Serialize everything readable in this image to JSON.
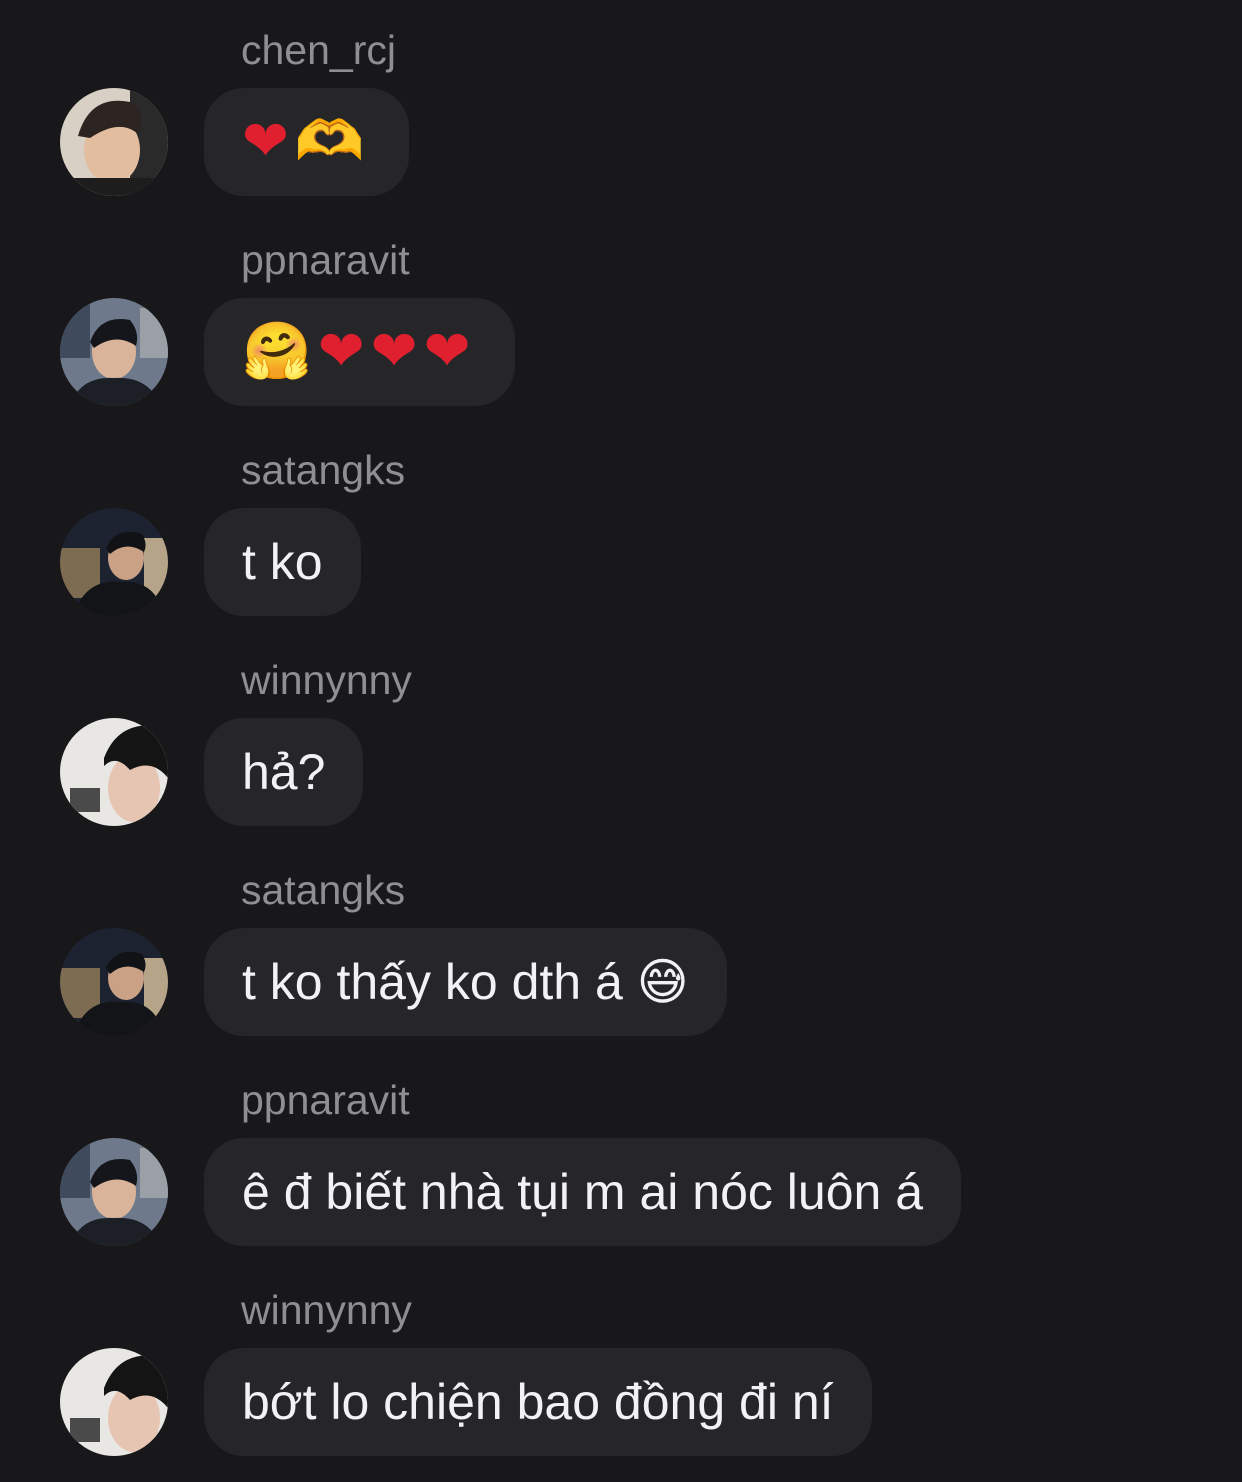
{
  "messages": [
    {
      "username": "chen_rcj",
      "text": "",
      "emoji": [
        "❤",
        "🫶"
      ],
      "avatar": "avatar-chen"
    },
    {
      "username": "ppnaravit",
      "text": "",
      "emoji": [
        "🤗",
        "❤",
        "❤",
        "❤"
      ],
      "avatar": "avatar-ppnaravit"
    },
    {
      "username": "satangks",
      "text": "t ko",
      "avatar": "avatar-satangks"
    },
    {
      "username": "winnynny",
      "text": "hả?",
      "avatar": "avatar-winnynny"
    },
    {
      "username": "satangks",
      "text": "t ko thấy ko dth á 😅",
      "avatar": "avatar-satangks"
    },
    {
      "username": "ppnaravit",
      "text": "ê đ biết nhà tụi m ai nóc luôn á",
      "avatar": "avatar-ppnaravit"
    },
    {
      "username": "winnynny",
      "text": "bớt lo chiện bao đồng đi ní",
      "avatar": "avatar-winnynny"
    }
  ],
  "colors": {
    "background": "#18181a",
    "bubble": "#262629",
    "username": "#8e8e93",
    "text": "#f2f2f4"
  }
}
